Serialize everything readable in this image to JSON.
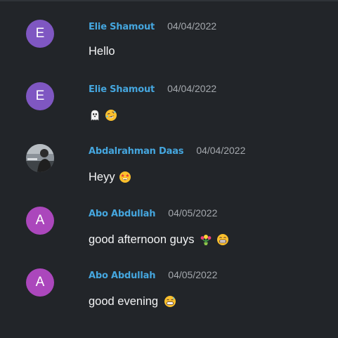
{
  "messages": [
    {
      "author": "Elie Shamout",
      "date": "04/04/2022",
      "text": "Hello",
      "avatar_letter": "E",
      "avatar_color": "#7f57c2",
      "emojis": []
    },
    {
      "author": "Elie Shamout",
      "date": "04/04/2022",
      "text": "",
      "avatar_letter": "E",
      "avatar_color": "#7f57c2",
      "emojis": [
        "ghost-emoji",
        "rolling-on-floor-laughing-emoji"
      ]
    },
    {
      "author": "Abdalrahman Daas",
      "date": "04/04/2022",
      "text": "Heyy",
      "avatar_letter": "",
      "avatar_color": "#6a7078",
      "emojis": [
        "star-struck-emoji"
      ]
    },
    {
      "author": "Abo Abdullah",
      "date": "04/05/2022",
      "text": "good afternoon guys",
      "avatar_letter": "A",
      "avatar_color": "#ab47bc",
      "emojis": [
        "tulip-bouquet-emoji",
        "grinning-squinting-emoji"
      ]
    },
    {
      "author": "Abo Abdullah",
      "date": "04/05/2022",
      "text": "good evening",
      "avatar_letter": "A",
      "avatar_color": "#ab47bc",
      "emojis": [
        "grinning-sweat-emoji"
      ]
    }
  ],
  "colors": {
    "background": "#222529",
    "author": "#45a6de",
    "date": "#a4a8ad",
    "text": "#f3f4f5"
  }
}
